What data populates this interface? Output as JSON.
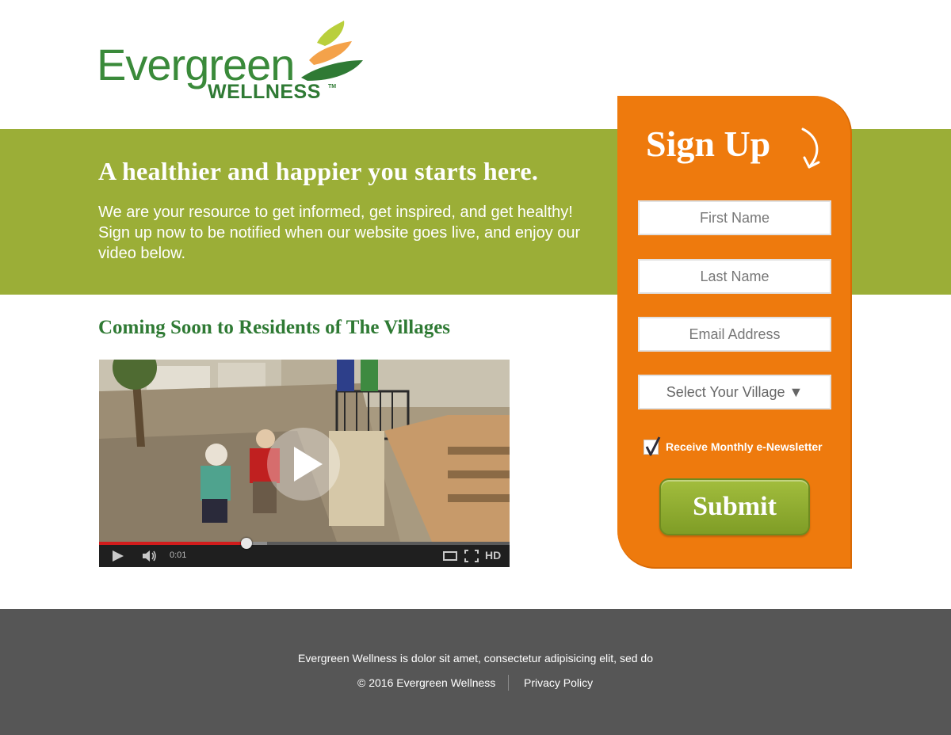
{
  "brand": {
    "name": "Evergreen",
    "sub": "WELLNESS",
    "tm": "TM",
    "colors": {
      "green_dark": "#2f7a34",
      "green_band": "#9bae37",
      "orange": "#ee7a0d",
      "leaf_lime": "#b9cf3c",
      "leaf_orange": "#f4a24a"
    }
  },
  "hero": {
    "title": "A healthier and happier you starts here.",
    "text": "We are your resource to get informed, get inspired, and get healthy! Sign up now to be notified when our website goes live, and enjoy our video below."
  },
  "section": {
    "heading": "Coming Soon to Residents of The Villages"
  },
  "video": {
    "time": "0:01",
    "hd_label": "HD",
    "progress": 0.36,
    "buffered": 0.41,
    "icons": [
      "play-icon",
      "volume-icon",
      "theater-mode-icon",
      "fullscreen-icon"
    ]
  },
  "signup": {
    "title": "Sign Up",
    "first_name_placeholder": "First Name",
    "last_name_placeholder": "Last Name",
    "email_placeholder": "Email Address",
    "village_select": "Select Your Village ▼",
    "newsletter_label": "Receive Monthly e-Newsletter",
    "newsletter_checked": true,
    "submit_label": "Submit"
  },
  "footer": {
    "tagline": "Evergreen Wellness is dolor sit amet, consectetur adipisicing elit, sed do",
    "copyright": "© 2016 Evergreen Wellness",
    "privacy": "Privacy Policy"
  }
}
